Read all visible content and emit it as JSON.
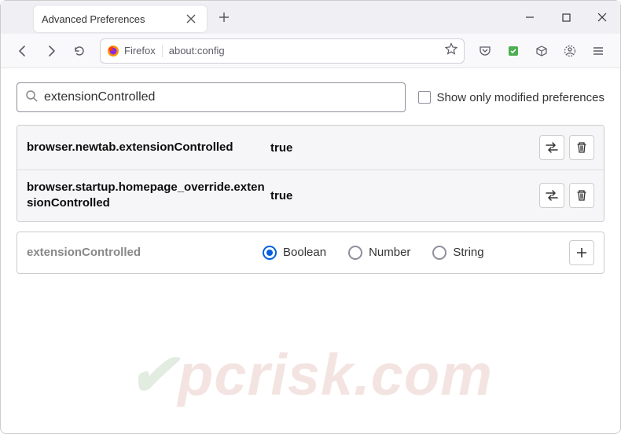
{
  "window": {
    "tab_title": "Advanced Preferences"
  },
  "urlbar": {
    "identity_label": "Firefox",
    "url": "about:config"
  },
  "search": {
    "value": "extensionControlled",
    "checkbox_label": "Show only modified preferences"
  },
  "prefs": [
    {
      "name": "browser.newtab.extensionControlled",
      "value": "true"
    },
    {
      "name": "browser.startup.homepage_override.extensionControlled",
      "value": "true"
    }
  ],
  "newpref": {
    "name": "extensionControlled",
    "types": [
      "Boolean",
      "Number",
      "String"
    ],
    "selected": 0
  },
  "watermark": "pcrisk.com"
}
